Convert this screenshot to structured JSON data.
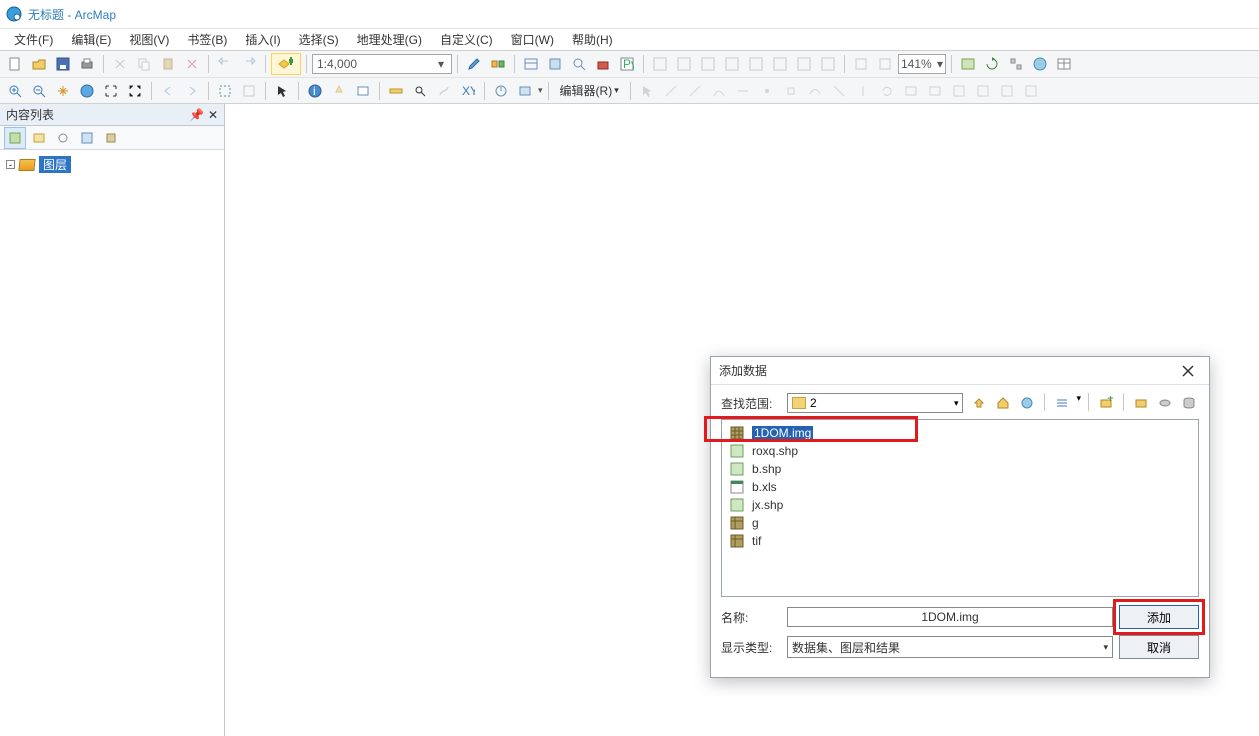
{
  "titlebar": {
    "title": "无标题 - ArcMap"
  },
  "menu": {
    "items": [
      "文件(F)",
      "编辑(E)",
      "视图(V)",
      "书签(B)",
      "插入(I)",
      "选择(S)",
      "地理处理(G)",
      "自定义(C)",
      "窗口(W)",
      "帮助(H)"
    ]
  },
  "toolbar": {
    "scale": "1:4,000",
    "zoom_pct": "141%",
    "editor_label": "编辑器(R)"
  },
  "toc": {
    "title": "内容列表",
    "root_label": "图层"
  },
  "dialog": {
    "title": "添加数据",
    "lookin_label": "查找范围:",
    "lookin_value": "2",
    "files": [
      {
        "name": "1DOM.img",
        "selected": true,
        "icon": "raster"
      },
      {
        "name": "roxq.shp",
        "selected": false,
        "icon": "shp"
      },
      {
        "name": "b.shp",
        "selected": false,
        "icon": "shp"
      },
      {
        "name": "b.xls",
        "selected": false,
        "icon": "xls"
      },
      {
        "name": "jx.shp",
        "selected": false,
        "icon": "shp"
      },
      {
        "name": "g",
        "selected": false,
        "icon": "raster"
      },
      {
        "name": "tif",
        "selected": false,
        "icon": "raster"
      }
    ],
    "name_label": "名称:",
    "name_value": "1DOM.img",
    "type_label": "显示类型:",
    "type_value": "数据集、图层和结果",
    "add_btn": "添加",
    "cancel_btn": "取消"
  }
}
